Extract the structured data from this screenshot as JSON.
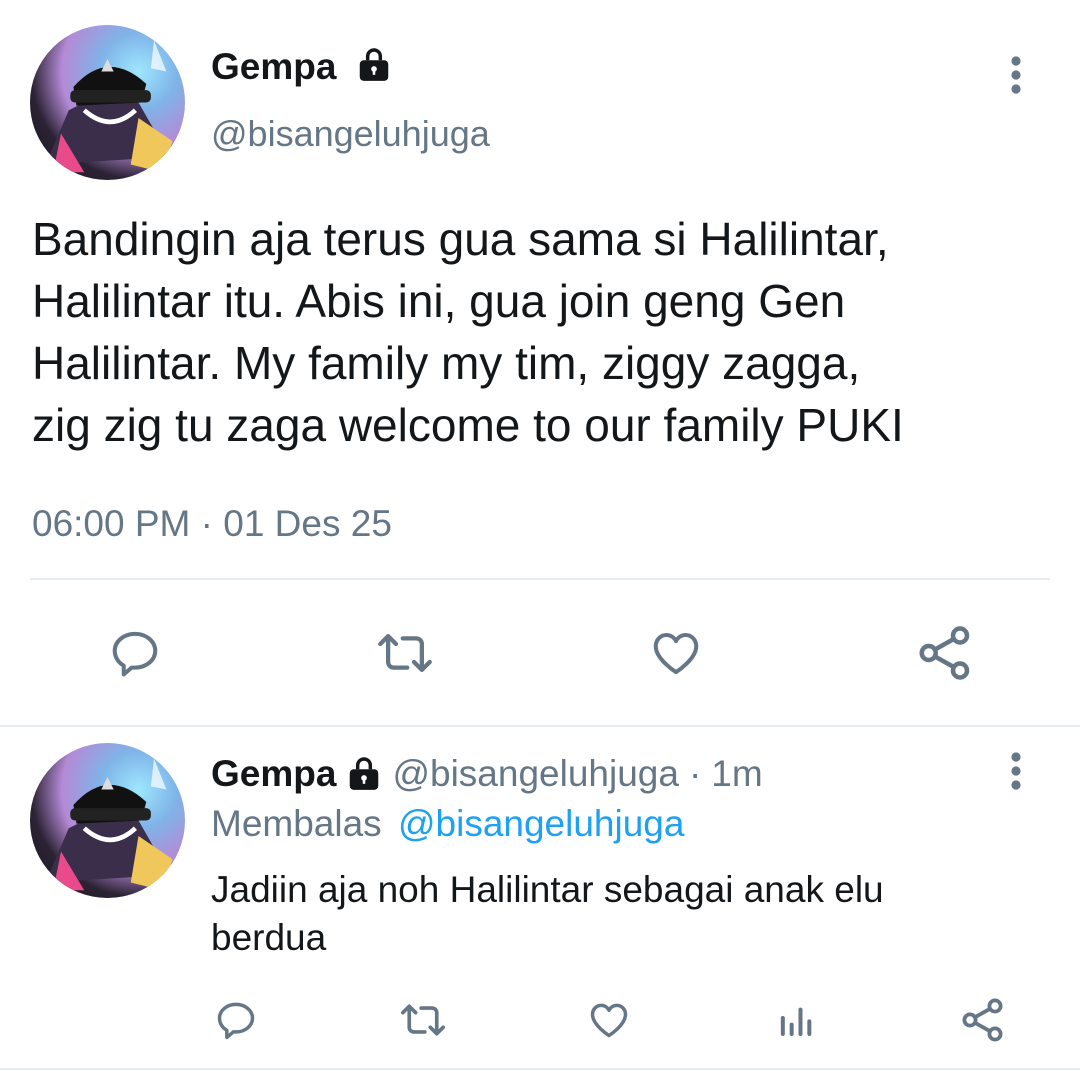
{
  "main_tweet": {
    "author_name": "Gempa",
    "handle": "@bisangeluhjuga",
    "text_lines": [
      "Bandingin aja terus gua sama si Halilintar,",
      "Halilintar itu. Abis ini, gua join geng Gen",
      "Halilintar. My family my tim, ziggy zagga,",
      "zig zig tu zaga welcome to our family PUKI"
    ],
    "timestamp": "06:00 PM · 01 Des 25"
  },
  "reply_tweet": {
    "author_name": "Gempa",
    "handle": "@bisangeluhjuga",
    "separator": "·",
    "time": "1m",
    "replying_label": "Membalas",
    "replying_to": "@bisangeluhjuga",
    "text_lines": [
      "Jadiin aja noh Halilintar sebagai anak elu",
      "berdua"
    ]
  },
  "icons": {
    "lock": "lock-icon",
    "more": "more-vertical-icon",
    "reply": "reply-icon",
    "retweet": "retweet-icon",
    "like": "like-icon",
    "share": "share-icon",
    "analytics": "analytics-icon"
  },
  "colors": {
    "link": "#1da1f2",
    "muted": "#657786",
    "text": "#14171a",
    "icon": "#657786",
    "divider": "#e6ecf0"
  }
}
